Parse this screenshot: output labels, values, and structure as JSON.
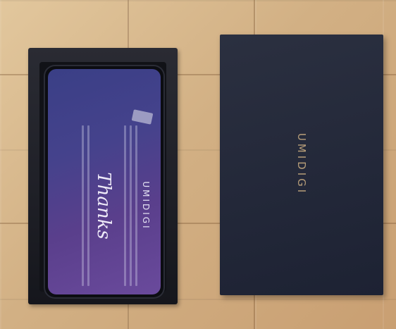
{
  "scene": {
    "description_colors": {
      "floor": "#d7b98c",
      "box": "#1f2029",
      "lid": "#262b3b",
      "screen": "#45428c",
      "logo": "#b79e79"
    }
  },
  "phone_card": {
    "brand": "UMIDIGI",
    "thanks": "Thanks"
  },
  "lid": {
    "logo": "UMIDIGI"
  }
}
